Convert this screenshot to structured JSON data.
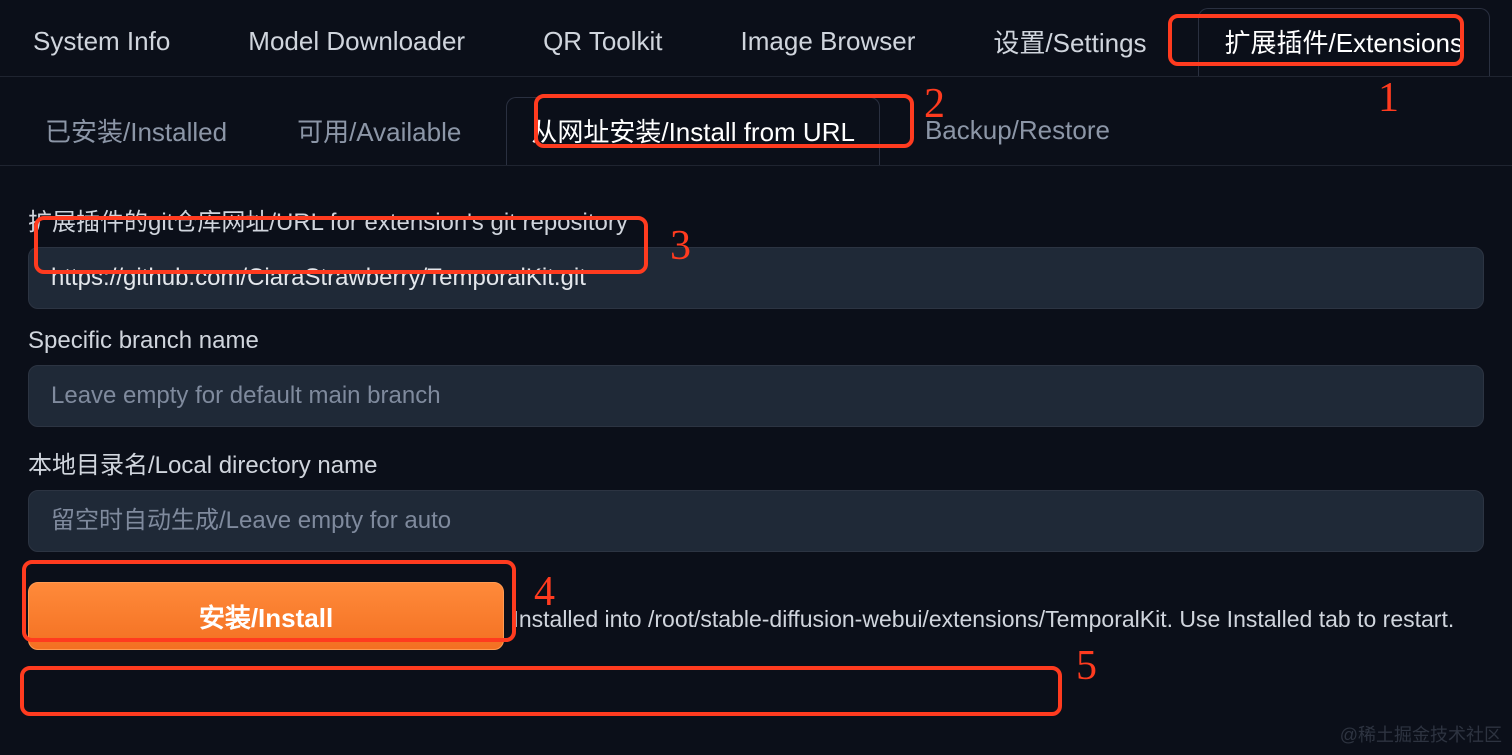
{
  "top_tabs": {
    "system_info": "System Info",
    "model_downloader": "Model Downloader",
    "qr_toolkit": "QR Toolkit",
    "image_browser": "Image Browser",
    "settings": "设置/Settings",
    "extensions": "扩展插件/Extensions"
  },
  "sub_tabs": {
    "installed": "已安装/Installed",
    "available": "可用/Available",
    "install_from_url": "从网址安装/Install from URL",
    "backup_restore": "Backup/Restore"
  },
  "form": {
    "repo_label": "扩展插件的git仓库网址/URL for extension's git repository",
    "repo_value": "https://github.com/CiaraStrawberry/TemporalKit.git",
    "branch_label": "Specific branch name",
    "branch_placeholder": "Leave empty for default main branch",
    "localdir_label": "本地目录名/Local directory name",
    "localdir_placeholder": "留空时自动生成/Leave empty for auto",
    "install_button": "安装/Install"
  },
  "status": "Installed into /root/stable-diffusion-webui/extensions/TemporalKit. Use Installed tab to restart.",
  "annotations": {
    "n1": "1",
    "n2": "2",
    "n3": "3",
    "n4": "4",
    "n5": "5"
  },
  "watermark": "@稀土掘金技术社区"
}
